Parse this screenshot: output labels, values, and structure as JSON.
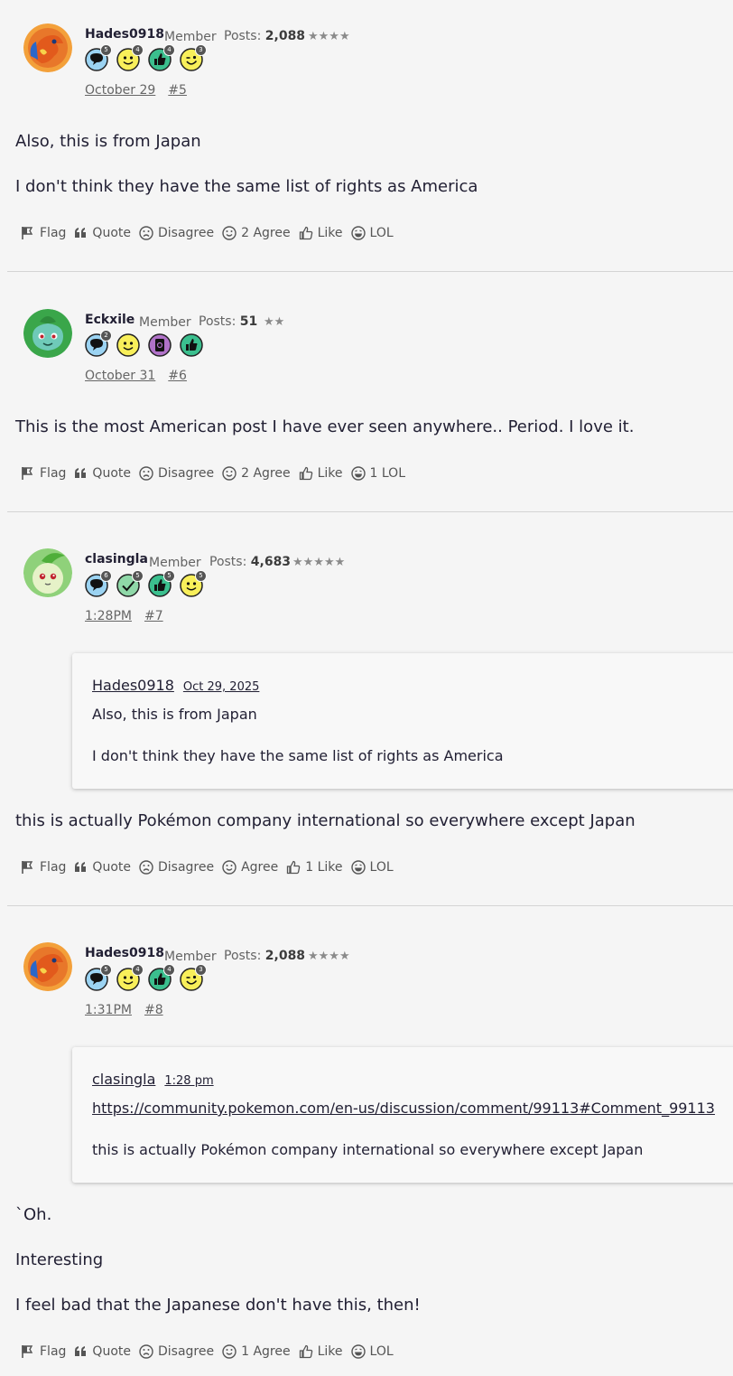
{
  "posts": [
    {
      "username": "Hades0918",
      "rank": "Member",
      "posts_label": "Posts:",
      "post_count": "2,088",
      "stars": "★★★★",
      "avatar_icon": "charizard-avatar-icon",
      "badges": [
        {
          "icon": "comment-badge-icon",
          "count": "5"
        },
        {
          "icon": "smile-badge-icon",
          "count": "4"
        },
        {
          "icon": "thumbs-up-badge-icon",
          "count": "4"
        },
        {
          "icon": "wink-badge-icon",
          "count": "3"
        }
      ],
      "date": "October 29",
      "post_number": "#5",
      "paragraphs": [
        "Also, this is from Japan",
        "I don't think they have the same list of rights as America"
      ],
      "actions": {
        "flag": "Flag",
        "quote": "Quote",
        "disagree": "Disagree",
        "agree": "2 Agree",
        "like": "Like",
        "lol": "LOL"
      }
    },
    {
      "username": "Eckxile",
      "rank": "Member",
      "posts_label": "Posts:",
      "post_count": "51",
      "stars": "★★",
      "avatar_icon": "bulbasaur-avatar-icon",
      "badges": [
        {
          "icon": "comment-badge-icon",
          "count": "2"
        },
        {
          "icon": "smile-badge-icon",
          "count": ""
        },
        {
          "icon": "mention-badge-icon",
          "count": ""
        },
        {
          "icon": "thumbs-up-badge-icon",
          "count": ""
        }
      ],
      "date": "October 31",
      "post_number": "#6",
      "paragraphs": [
        "This is the most American post I have ever seen anywhere.. Period. I love it."
      ],
      "actions": {
        "flag": "Flag",
        "quote": "Quote",
        "disagree": "Disagree",
        "agree": "2 Agree",
        "like": "Like",
        "lol": "1 LOL"
      }
    },
    {
      "username": "clasingla",
      "rank": "Member",
      "posts_label": "Posts:",
      "post_count": "4,683",
      "stars": "★★★★★",
      "avatar_icon": "chikorita-avatar-icon",
      "badges": [
        {
          "icon": "comment-badge-icon",
          "count": "6"
        },
        {
          "icon": "check-badge-icon",
          "count": "5"
        },
        {
          "icon": "thumbs-up-badge-icon",
          "count": "5"
        },
        {
          "icon": "smile-badge-icon",
          "count": "5"
        }
      ],
      "date": "1:28PM",
      "post_number": "#7",
      "quote": {
        "author": "Hades0918",
        "date": "Oct 29, 2025",
        "lines": [
          "Also, this is from Japan",
          "I don't think they have the same list of rights as America"
        ]
      },
      "paragraphs": [
        "this is actually Pokémon company international so everywhere except Japan"
      ],
      "actions": {
        "flag": "Flag",
        "quote": "Quote",
        "disagree": "Disagree",
        "agree": "Agree",
        "like": "1 Like",
        "lol": "LOL"
      }
    },
    {
      "username": "Hades0918",
      "rank": "Member",
      "posts_label": "Posts:",
      "post_count": "2,088",
      "stars": "★★★★",
      "avatar_icon": "charizard-avatar-icon",
      "badges": [
        {
          "icon": "comment-badge-icon",
          "count": "5"
        },
        {
          "icon": "smile-badge-icon",
          "count": "4"
        },
        {
          "icon": "thumbs-up-badge-icon",
          "count": "4"
        },
        {
          "icon": "wink-badge-icon",
          "count": "3"
        }
      ],
      "date": "1:31PM",
      "post_number": "#8",
      "quote": {
        "author": "clasingla",
        "date": "1:28 pm",
        "link": "https://community.pokemon.com/en-us/discussion/comment/99113#Comment_99113",
        "lines": [
          "this is actually Pokémon company international so everywhere except Japan"
        ]
      },
      "paragraphs": [
        "`Oh.",
        "Interesting",
        "I feel bad that the Japanese don't have this, then!"
      ],
      "actions": {
        "flag": "Flag",
        "quote": "Quote",
        "disagree": "Disagree",
        "agree": "1 Agree",
        "like": "Like",
        "lol": "LOL"
      }
    }
  ],
  "colors": {
    "text": "#222034",
    "muted": "#646464",
    "background": "#f5f5f5",
    "divider": "#d4d4d4"
  }
}
